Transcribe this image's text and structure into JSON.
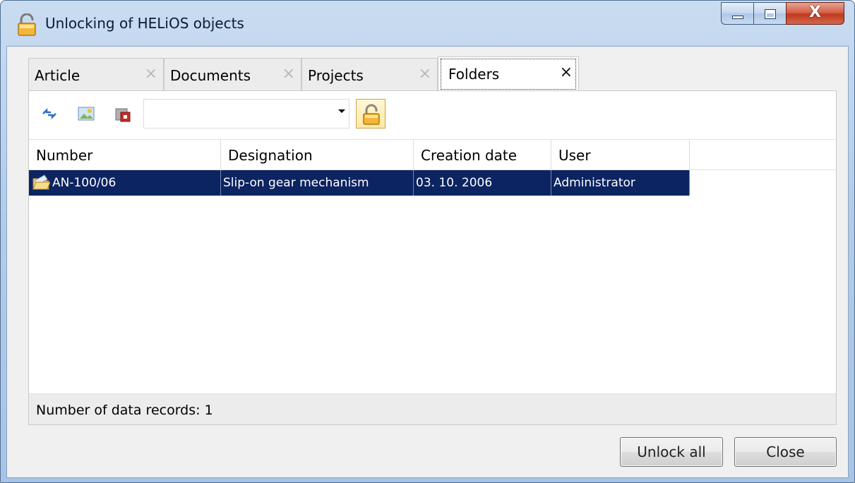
{
  "window": {
    "title": "Unlocking of HELiOS objects",
    "close_glyph": "X"
  },
  "tabs": [
    {
      "label": "Article",
      "close": "×"
    },
    {
      "label": "Documents",
      "close": "×"
    },
    {
      "label": "Projects",
      "close": "×"
    },
    {
      "label": "Folders",
      "close": "×",
      "active": true
    }
  ],
  "toolbar": {
    "combo_value": "",
    "icons": [
      "refresh-icon",
      "image-icon",
      "delete-icon",
      "lock-icon"
    ]
  },
  "grid": {
    "columns": [
      "Number",
      "Designation",
      "Creation date",
      "User"
    ],
    "rows": [
      {
        "number": "AN-100/06",
        "designation": "Slip-on gear mechanism",
        "creation_date": "03. 10. 2006",
        "user": "Administrator",
        "selected": true
      }
    ]
  },
  "status": {
    "records_text": "Number of data records: 1"
  },
  "buttons": {
    "unlock_all": "Unlock all",
    "close": "Close"
  },
  "colors": {
    "selection": "#0c2461",
    "title_gradient": "#b3cbe8",
    "close_button": "#c1391f"
  }
}
